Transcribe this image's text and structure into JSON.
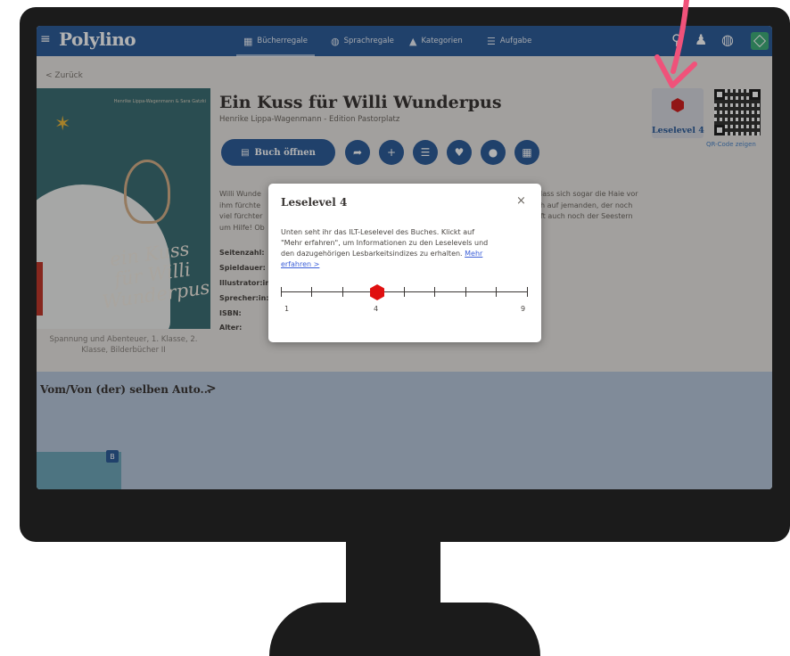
{
  "nav": {
    "logo": "Polylino",
    "items": [
      {
        "label": "Bücherregale",
        "icon": "grid-icon"
      },
      {
        "label": "Sprachregale",
        "icon": "globe-icon"
      },
      {
        "label": "Kategorien",
        "icon": "shapes-icon"
      },
      {
        "label": "Aufgabe",
        "icon": "checklist-icon"
      }
    ]
  },
  "back_label": "< Zurück",
  "book": {
    "title": "Ein Kuss für Willi Wunderpus",
    "subtitle": "Henrike Lippa-Wagenmann - Edition Pastorplatz",
    "open_button": "Buch öffnen",
    "cover_title": "ein Kuss für Willi Wunderpus",
    "cover_authors": "Henrike Lippa-Wagenmann & Sara Gatzki",
    "caption": "Spannung und Abenteuer, 1. Klasse, 2. Klasse, Bilderbücher II",
    "desc_left": [
      "Willi Wunde",
      "ihm fürchte",
      "viel fürchter",
      "um Hilfe! Ob"
    ],
    "desc_right": [
      "lass sich sogar die Haie vor",
      "h auf jemanden, der noch",
      "ft auch noch der Seestern"
    ],
    "meta_labels": [
      "Seitenzahl:",
      "Spieldauer:",
      "Illustrator:in",
      "Sprecher:in:",
      "ISBN:",
      "Alter:"
    ]
  },
  "level_card": {
    "label": "Leselevel 4"
  },
  "qr_label": "QR-Code zeigen",
  "band": {
    "title": "Vom/Von (der) selben Auto...",
    "arrow": ">",
    "badge": "B"
  },
  "modal": {
    "title": "Leselevel 4",
    "close": "×",
    "lines": [
      "Unten seht ihr das ILT-Leselevel des Buches. Klickt auf",
      "\"Mehr erfahren\", um Informationen zu den Leselevels und",
      "den dazugehörigen Lesbarkeitsindizes zu erhalten."
    ],
    "link_part1": "Mehr",
    "link_part2": "erfahren >",
    "scale": {
      "min": 1,
      "max": 9,
      "current": 4,
      "min_label": "1",
      "current_label": "4",
      "max_label": "9"
    }
  },
  "colors": {
    "brand_blue": "#2f5d9a",
    "level_red": "#e01010",
    "arrow_pink": "#f0527a"
  }
}
